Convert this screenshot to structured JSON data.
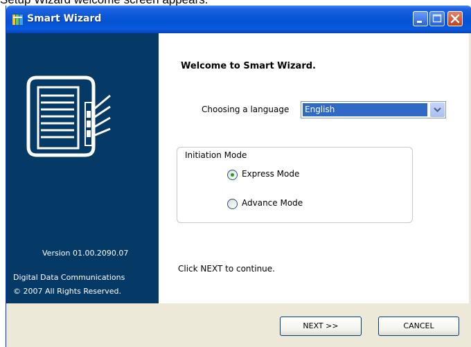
{
  "caption": "Setup Wizard welcome screen appears.",
  "window": {
    "title": "Smart Wizard"
  },
  "sidebar": {
    "version": "Version 01.00.2090.07",
    "company": "Digital Data Communications",
    "copyright": "© 2007 All Rights Reserved."
  },
  "main": {
    "welcome": "Welcome to Smart Wizard.",
    "language_label": "Choosing a language",
    "language_value": "English",
    "initiation": {
      "title": "Initiation Mode",
      "options": [
        {
          "label": "Express Mode",
          "selected": true
        },
        {
          "label": "Advance Mode",
          "selected": false
        }
      ]
    },
    "continue_text": "Click NEXT to continue."
  },
  "buttons": {
    "next": "NEXT  >>",
    "cancel": "CANCEL"
  },
  "colors": {
    "sidebar_bg": "#063a66",
    "titlebar": "#0553d2",
    "selection": "#316ac5",
    "radio_dot": "#21a121"
  },
  "icons": {
    "app": "wizard-app-icon",
    "device": "nas-server-icon",
    "dropdown": "chevron-down-icon"
  }
}
